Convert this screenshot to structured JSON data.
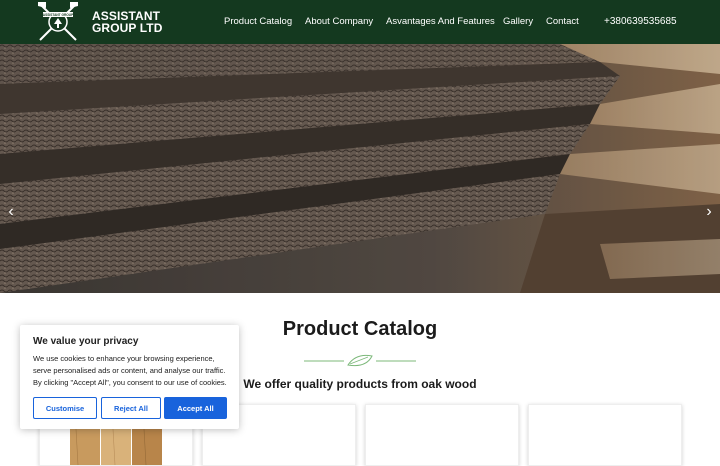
{
  "header": {
    "brand": "ASSISTANT GROUP LTD",
    "logo_text": "ASSISTANT GROUP",
    "nav": [
      "Product Catalog",
      "About Company",
      "Asvantages And Features",
      "Gallery",
      "Contact"
    ],
    "phone": "+380639535685",
    "background": "#14391f"
  },
  "hero": {
    "prev_icon": "chevron-left-icon",
    "next_icon": "chevron-right-icon"
  },
  "catalog": {
    "title": "Product Catalog",
    "subtitle": "We offer quality products from oak wood",
    "divider_icon": "leaf-icon",
    "divider_color": "#7cb87a"
  },
  "cookie": {
    "title": "We value your privacy",
    "text": "We use cookies to enhance your browsing experience, serve personalised ads or content, and analyse our traffic. By clicking \"Accept All\", you consent to our use of cookies.",
    "customise": "Customise",
    "reject": "Reject All",
    "accept": "Accept All",
    "accent": "#1863dc"
  }
}
